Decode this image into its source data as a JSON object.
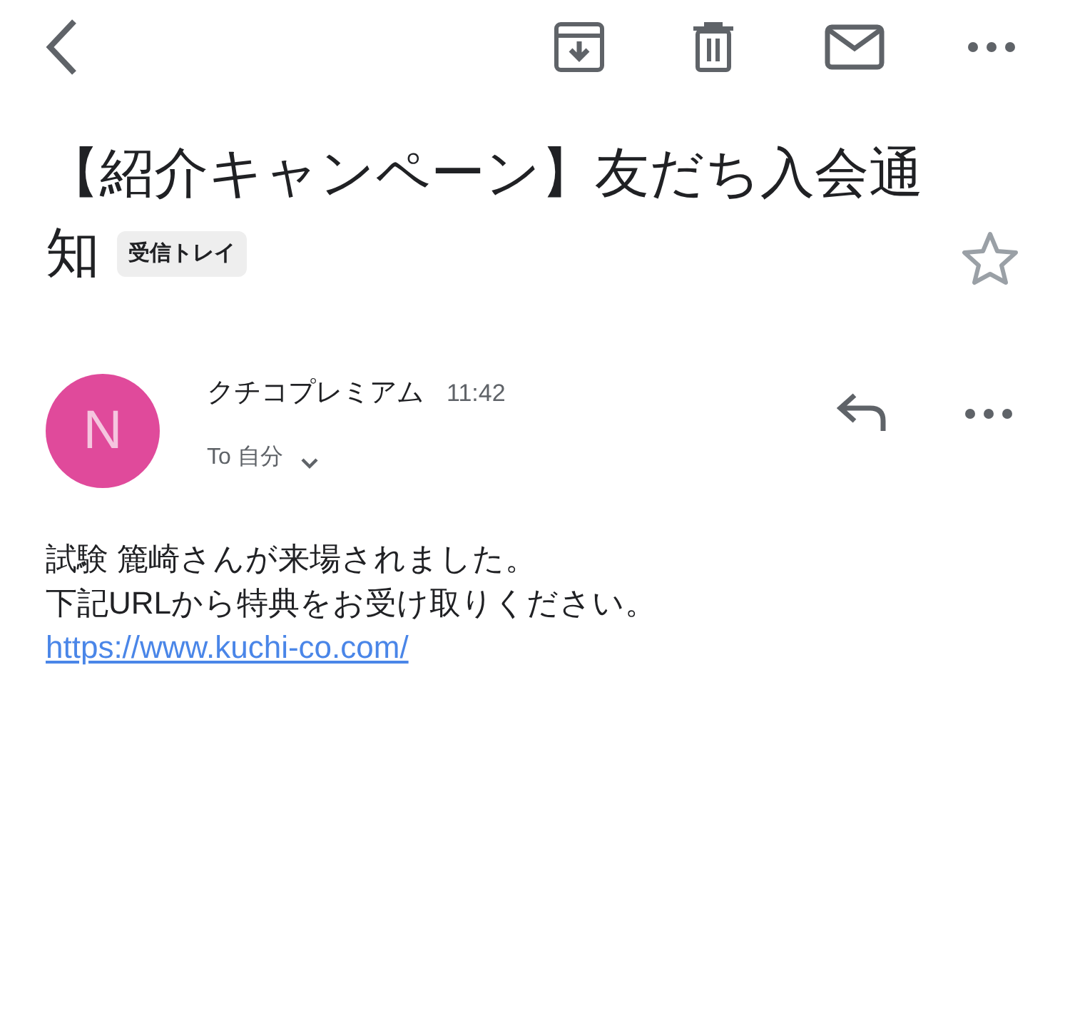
{
  "subject": {
    "title_lines": [
      "【紹介キャンペーン】友だち入会通",
      "知"
    ],
    "label": "受信トレイ",
    "starred": false
  },
  "message": {
    "avatar_initial": "N",
    "sender": "クチコプレミアム",
    "time": "11:42",
    "recipient": "To 自分",
    "details_expanded": false,
    "body": [
      "試験 簏崎さんが来場されました。",
      "下記URLから特典をお受け取りください。"
    ],
    "link": "https://www.kuchi-co.com/"
  }
}
